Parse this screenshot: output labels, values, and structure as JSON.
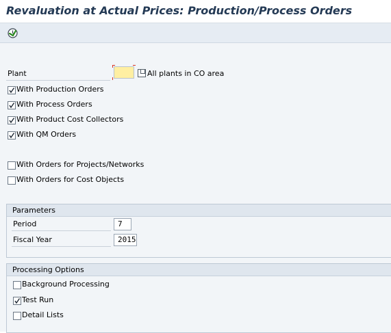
{
  "window": {
    "title": "Revaluation at Actual Prices: Production/Process Orders"
  },
  "toolbar": {
    "execute_icon": "execute-clock-icon"
  },
  "selection": {
    "plant_label": "Plant",
    "plant_value": "",
    "all_plants_label": "All plants in CO area",
    "all_plants_checked": false,
    "order_types": [
      {
        "label": "With Production Orders",
        "checked": true
      },
      {
        "label": "With Process Orders",
        "checked": true
      },
      {
        "label": "With Product Cost Collectors",
        "checked": true
      },
      {
        "label": "With QM Orders",
        "checked": true
      }
    ],
    "other_orders": [
      {
        "label": "With Orders for Projects/Networks",
        "checked": false
      },
      {
        "label": "With Orders for Cost Objects",
        "checked": false
      }
    ]
  },
  "parameters": {
    "header": "Parameters",
    "period_label": "Period",
    "period_value": "7",
    "fiscal_year_label": "Fiscal Year",
    "fiscal_year_value": "2015"
  },
  "processing": {
    "header": "Processing Options",
    "options": [
      {
        "label": "Background Processing",
        "checked": false
      },
      {
        "label": "Test Run",
        "checked": true
      },
      {
        "label": "Detail Lists",
        "checked": false
      }
    ]
  },
  "colors": {
    "title": "#243a55",
    "required_field": "#ffefa2",
    "required_marker": "#d9301e",
    "execute_icon": "#2a8a1f"
  }
}
